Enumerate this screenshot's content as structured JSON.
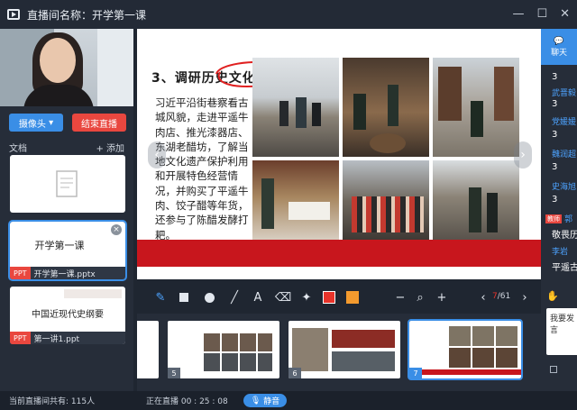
{
  "window": {
    "title": "直播间名称：开学第一课"
  },
  "left": {
    "camera_button": "摄像头",
    "end_button": "结束直播",
    "docs_label": "文档",
    "add_label": "+ 添加",
    "docs": [
      {
        "label": "",
        "type": ""
      },
      {
        "title": "开学第一课",
        "label": "开学第一课.pptx",
        "type": "PPT"
      },
      {
        "title": "中国近现代史纲要",
        "label": "第一讲1.ppt",
        "type": "PPT"
      }
    ]
  },
  "slide": {
    "heading": "3、调研历史文化遗产",
    "body": "习近平沿街巷察看古城风貌，走进平遥牛肉店、推光漆器店、东湖老醋坊，了解当地文化遗产保护利用和开展特色经营情况，并购买了平遥牛肉、饺子醋等年货，还参与了陈醋发酵打耙。"
  },
  "toolbar": {
    "page_current": "7",
    "page_total": "/61",
    "colors": {
      "red": "#e8332a",
      "orange": "#f39a2e"
    }
  },
  "thumbs": [
    {
      "num": "5"
    },
    {
      "num": "6"
    },
    {
      "num": "7"
    }
  ],
  "chat": {
    "tab_label": "聊天",
    "messages": [
      {
        "name": "",
        "text": "3"
      },
      {
        "name": "武晋毅",
        "text": "3"
      },
      {
        "name": "党媛媛",
        "text": "3"
      },
      {
        "name": "魏润超",
        "text": "3"
      },
      {
        "name": "史海旭",
        "text": "3"
      },
      {
        "name": "郭",
        "text": "敬畏历",
        "teacher": "教师"
      },
      {
        "name": "李岩",
        "text": "平遥古"
      }
    ],
    "input_text": "我要发言"
  },
  "footer": {
    "online": "当前直播间共有: 115人",
    "live_time": "正在直播 00 : 25 : 08",
    "mute": "静音"
  }
}
